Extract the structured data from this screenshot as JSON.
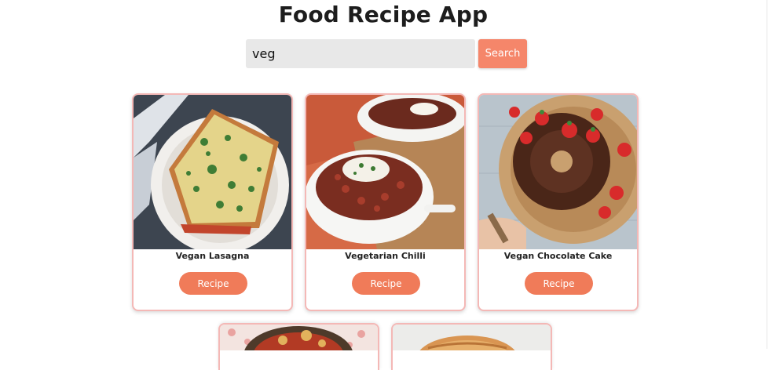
{
  "app": {
    "title": "Food Recipe App"
  },
  "search": {
    "value": "veg",
    "button_label": "Search"
  },
  "recipes": [
    {
      "name": "Vegan Lasagna",
      "button_label": "Recipe"
    },
    {
      "name": "Vegetarian Chilli",
      "button_label": "Recipe"
    },
    {
      "name": "Vegan Chocolate Cake",
      "button_label": "Recipe"
    }
  ],
  "colors": {
    "accent": "#f07b59",
    "card_border": "#f4b8b6",
    "input_bg": "#e8e8e8"
  }
}
